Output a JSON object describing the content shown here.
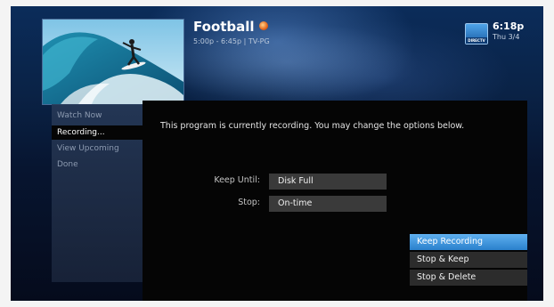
{
  "program": {
    "title": "Football",
    "time_rating": "5:00p - 6:45p | TV-PG",
    "status_icon": "recording-dot-icon"
  },
  "header": {
    "clock": "6:18p",
    "date": "Thu 3/4",
    "logo_text": "DIRECTV"
  },
  "sidebar": {
    "items": [
      {
        "label": "Watch Now",
        "selected": false
      },
      {
        "label": "Recording...",
        "selected": true
      },
      {
        "label": "View Upcoming",
        "selected": false
      },
      {
        "label": "Done",
        "selected": false
      }
    ]
  },
  "panel": {
    "message": "This program is currently recording. You may change the options below.",
    "options": [
      {
        "label": "Keep Until:",
        "value": "Disk Full"
      },
      {
        "label": "Stop:",
        "value": "On-time"
      }
    ]
  },
  "actions": [
    {
      "label": "Keep Recording",
      "highlighted": true
    },
    {
      "label": "Stop & Keep",
      "highlighted": false
    },
    {
      "label": "Stop & Delete",
      "highlighted": false
    }
  ],
  "colors": {
    "highlight": "#2a80cc",
    "background": "#0a2347",
    "panel": "#050505"
  }
}
